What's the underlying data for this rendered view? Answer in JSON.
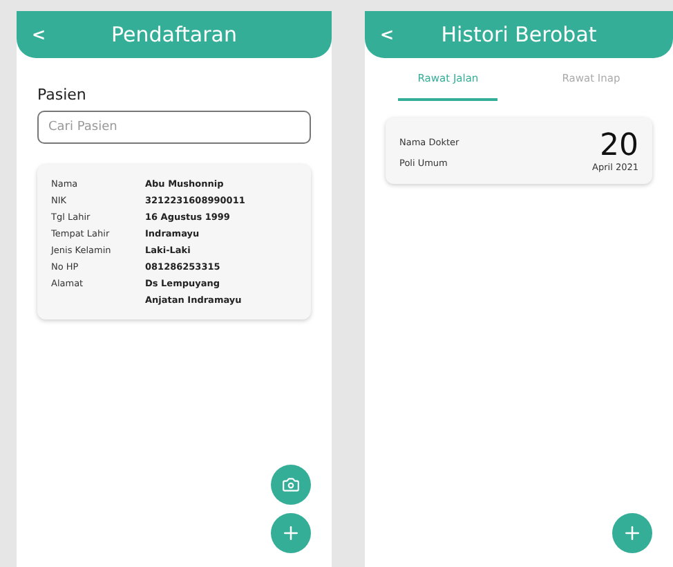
{
  "registration": {
    "title": "Pendaftaran",
    "back": "<",
    "patient_label": "Pasien",
    "search": {
      "placeholder": "Cari Pasien"
    },
    "details": [
      {
        "label": "Nama",
        "value": "Abu Mushonnip"
      },
      {
        "label": "NIK",
        "value": "3212231608990011"
      },
      {
        "label": "Tgl Lahir",
        "value": "16 Agustus 1999"
      },
      {
        "label": "Tempat Lahir",
        "value": "Indramayu"
      },
      {
        "label": "Jenis Kelamin",
        "value": "Laki-Laki"
      },
      {
        "label": "No HP",
        "value": "081286253315"
      },
      {
        "label": "Alamat",
        "value": "Ds Lempuyang"
      },
      {
        "value": "Anjatan Indramayu"
      }
    ]
  },
  "history": {
    "title": "Histori Berobat",
    "back": "<",
    "tabs": [
      {
        "label": "Rawat Jalan",
        "selected": true
      },
      {
        "label": "Rawat Inap",
        "selected": false
      }
    ],
    "visits": [
      {
        "doctor": "Nama Dokter",
        "clinic": "Poli Umum",
        "day": "20",
        "month": "April 2021"
      }
    ]
  }
}
